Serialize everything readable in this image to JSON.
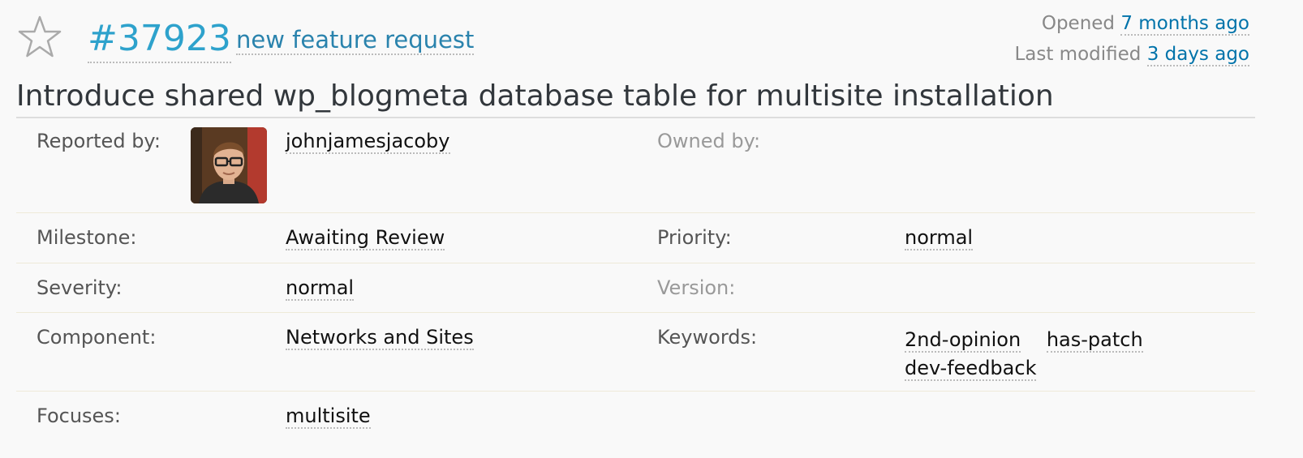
{
  "ticket": {
    "number": "#37923",
    "type": "new feature request",
    "summary": "Introduce shared wp_blogmeta database table for multisite installation"
  },
  "dates": {
    "opened_label": "Opened",
    "opened_value": "7 months ago",
    "modified_label": "Last modified",
    "modified_value": "3 days ago"
  },
  "props": {
    "reported_by_label": "Reported by:",
    "reported_by_value": "johnjamesjacoby",
    "owned_by_label": "Owned by:",
    "milestone_label": "Milestone:",
    "milestone_value": "Awaiting Review",
    "priority_label": "Priority:",
    "priority_value": "normal",
    "severity_label": "Severity:",
    "severity_value": "normal",
    "version_label": "Version:",
    "component_label": "Component:",
    "component_value": "Networks and Sites",
    "keywords_label": "Keywords:",
    "keywords": [
      "2nd-opinion",
      "has-patch",
      "dev-feedback"
    ],
    "focuses_label": "Focuses:",
    "focuses_value": "multisite"
  },
  "colors": {
    "accent": "#2ea2cc",
    "link": "#0073aa",
    "muted": "#999999"
  },
  "icons": {
    "star": "star-outline-icon"
  }
}
